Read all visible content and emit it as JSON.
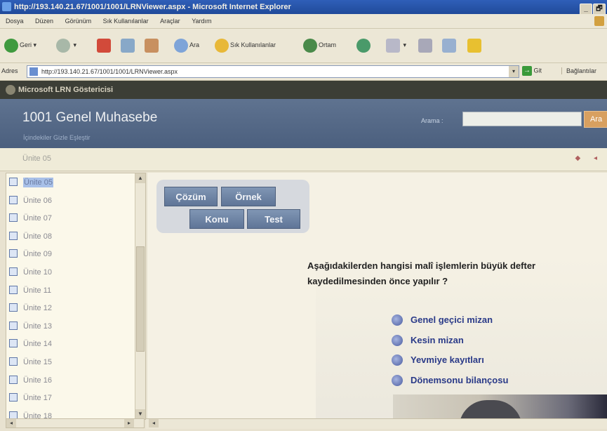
{
  "window": {
    "title": "http://193.140.21.67/1001/1001/LRNViewer.aspx - Microsoft Internet Explorer",
    "controls": [
      "_",
      "🗗"
    ]
  },
  "menu": [
    "Dosya",
    "Düzen",
    "Görünüm",
    "Sık Kullanılanlar",
    "Araçlar",
    "Yardım"
  ],
  "toolbar": {
    "back": "Geri",
    "search": "Ara",
    "favorites": "Sık Kullanılanlar",
    "media": "Ortam"
  },
  "address": {
    "label": "Adres",
    "url": "http://193.140.21.67/1001/1001/LRNViewer.aspx",
    "go": "Git",
    "links": "Bağlantılar"
  },
  "viewer": {
    "brand": "Microsoft LRN Göstericisi",
    "title": "1001 Genel Muhasebe",
    "subnav": "İçindekiler Gizle   Eşleştir",
    "search_label": "Arama :",
    "search_value": "",
    "search_button": "Ara",
    "breadcrumb": "Ünite 05",
    "nav_arrows": "◆ ◂"
  },
  "sidebar": {
    "items": [
      {
        "label": "Ünite 05",
        "selected": true
      },
      {
        "label": "Ünite 06"
      },
      {
        "label": "Ünite 07"
      },
      {
        "label": "Ünite 08"
      },
      {
        "label": "Ünite 09"
      },
      {
        "label": "Ünite 10"
      },
      {
        "label": "Ünite 11"
      },
      {
        "label": "Ünite 12"
      },
      {
        "label": "Ünite 13"
      },
      {
        "label": "Ünite 14"
      },
      {
        "label": "Ünite 15"
      },
      {
        "label": "Ünite 16"
      },
      {
        "label": "Ünite 17"
      },
      {
        "label": "Ünite 18"
      }
    ]
  },
  "lesson": {
    "buttons": {
      "cozum": "Çözüm",
      "ornek": "Örnek",
      "konu": "Konu",
      "test": "Test"
    },
    "question_line1": "Aşağıdakilerden hangisi malî işlemlerin büyük defter",
    "question_line2": "kaydedilmesinden önce yapılır ?",
    "options": [
      "Genel geçici mizan",
      "Kesin mizan",
      "Yevmiye kayıtları",
      "Dönemsonu bilançosu"
    ]
  },
  "colors": {
    "header_bg": "#56698a",
    "button_bg": "#6f85a6",
    "option_text": "#2a3a88"
  }
}
